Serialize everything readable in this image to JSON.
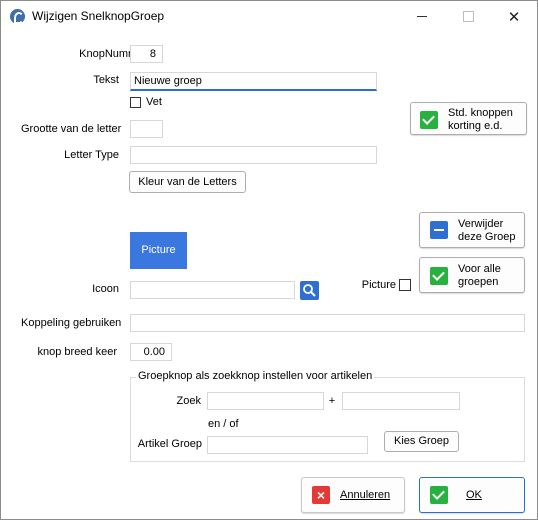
{
  "window": {
    "title": "Wijzigen SnelknopGroep",
    "minimize_label": "—",
    "maximize_label": "☐",
    "close_label": "✕"
  },
  "form": {
    "knopnummer_label": "KnopNummer",
    "knopnummer_value": "8",
    "tekst_label": "Tekst",
    "tekst_value": "Nieuwe groep",
    "vet_label": "Vet",
    "grootte_label": "Grootte van de letter",
    "grootte_value": "",
    "lettertype_label": "Letter Type",
    "lettertype_value": "",
    "kleur_button": "Kleur van de Letters",
    "picture_button": "Picture",
    "icoon_label": "Icoon",
    "icoon_value": "",
    "picture_check_label": "Picture",
    "koppeling_label": "Koppeling gebruiken",
    "koppeling_value": "",
    "knopbreed_label": "knop breed keer",
    "knopbreed_value": "0.00"
  },
  "side_buttons": {
    "std_line1": "Std. knoppen",
    "std_line2": "korting e.d.",
    "verwijder_line1": "Verwijder",
    "verwijder_line2": "deze Groep",
    "voor_alle_line1": "Voor alle",
    "voor_alle_line2": "groepen"
  },
  "group": {
    "title": "Groepknop als zoekknop instellen voor artikelen",
    "zoek_label": "Zoek",
    "zoek_value1": "",
    "plus": "+",
    "zoek_value2": "",
    "en_of": "en / of",
    "artikel_label": "Artikel Groep",
    "artikel_value": "",
    "kies_button": "Kies Groep"
  },
  "footer": {
    "annuleren_button": "Annuleren",
    "ok_button": "OK"
  },
  "colors": {
    "accent": "#2a6fd0",
    "picture_button": "#3a78e0",
    "ok_green": "#27b13f",
    "cancel_red": "#e53935"
  }
}
